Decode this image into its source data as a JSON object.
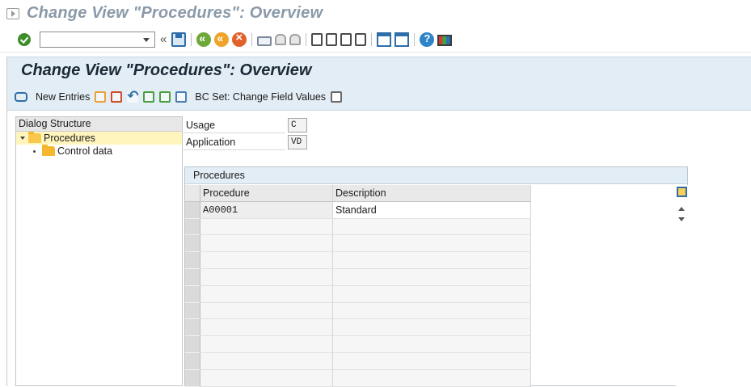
{
  "window": {
    "title": "Change View \"Procedures\": Overview"
  },
  "toolbar": {
    "command_field_value": "",
    "icons": [
      "enter-icon",
      "save-icon",
      "back-icon",
      "exit-icon",
      "cancel-icon",
      "print-icon",
      "find-icon",
      "find-next-icon",
      "first-page-icon",
      "previous-page-icon",
      "next-page-icon",
      "last-page-icon",
      "create-session-icon",
      "shortcut-icon",
      "help-icon",
      "customize-layout-icon"
    ]
  },
  "screen": {
    "title": "Change View \"Procedures\": Overview"
  },
  "app_toolbar": {
    "new_entries_label": "New Entries",
    "bc_set_label": "BC Set: Change Field Values"
  },
  "dialog_structure": {
    "header": "Dialog Structure",
    "items": [
      {
        "label": "Procedures",
        "expanded": true,
        "selected": true
      },
      {
        "label": "Control data",
        "expanded": false,
        "selected": false
      }
    ]
  },
  "fields": {
    "usage_label": "Usage",
    "usage_value": "C",
    "application_label": "Application",
    "application_value": "VD"
  },
  "procedures_table": {
    "title": "Procedures",
    "columns": [
      "Procedure",
      "Description"
    ],
    "rows": [
      {
        "procedure": "A00001",
        "description": "Standard"
      }
    ],
    "empty_rows": 10
  },
  "colors": {
    "header_bg": "#e3edf5",
    "title_muted": "#8a9aa8",
    "selected_row": "#fff5bd",
    "folder": "#f5b72c"
  }
}
